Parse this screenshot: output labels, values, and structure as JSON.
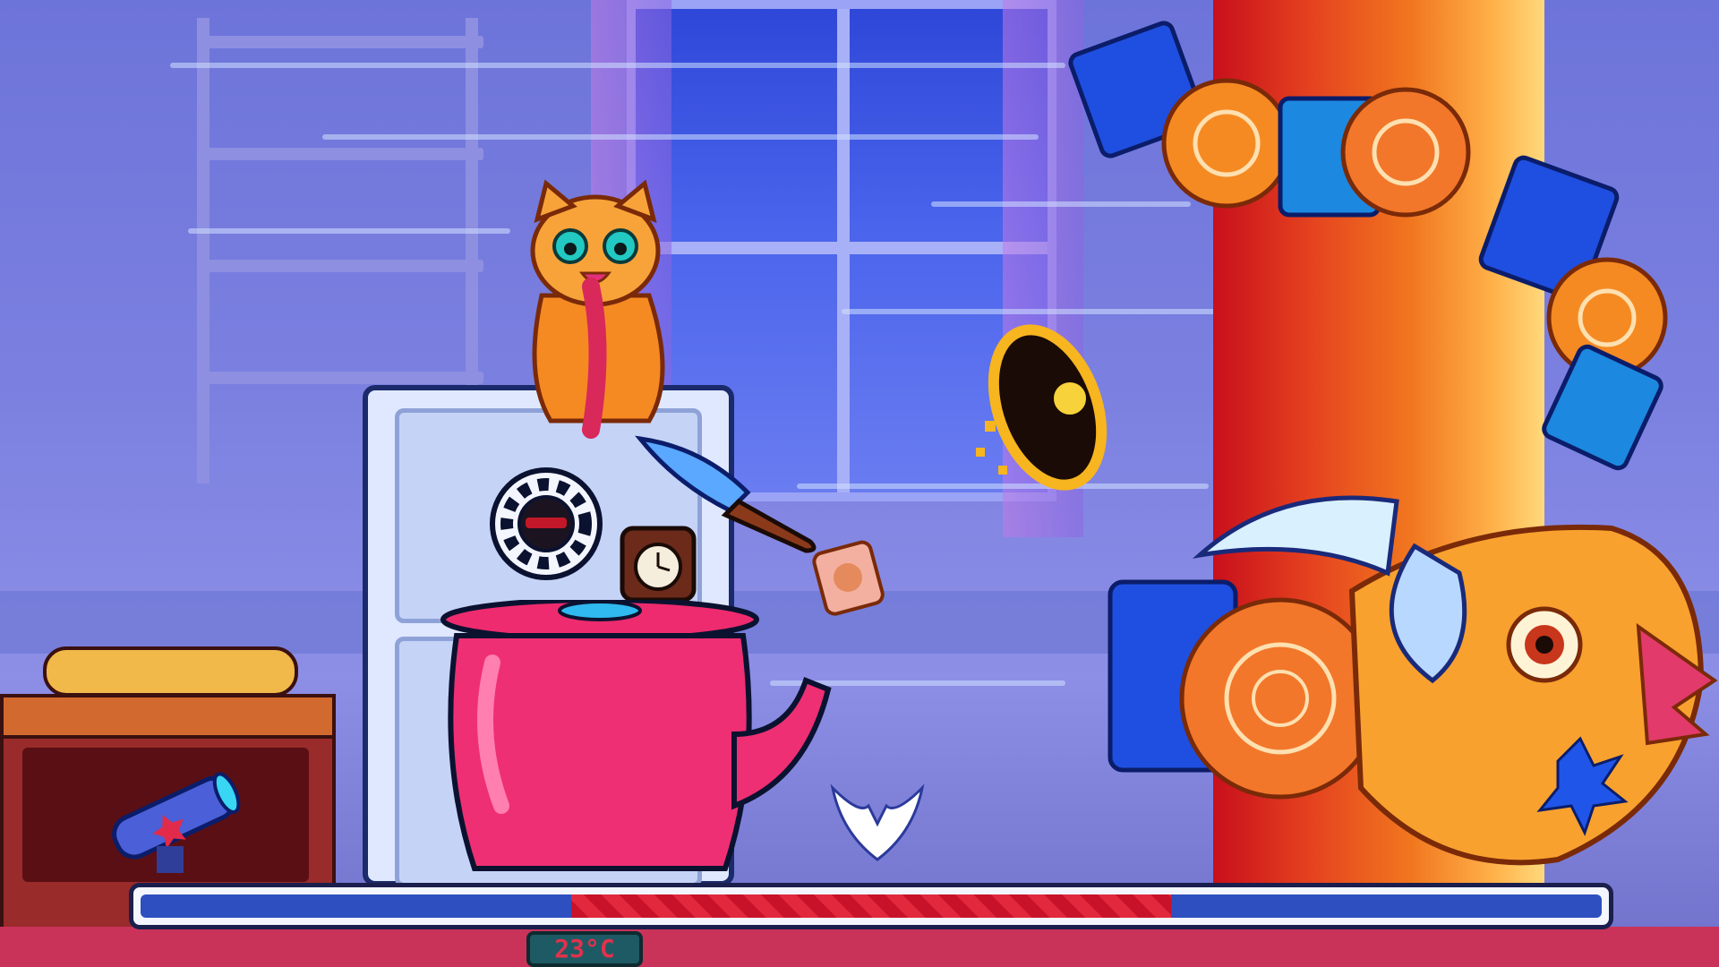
{
  "hud": {
    "thermometer_reading": "23°C",
    "progress_fraction": 0.41,
    "progress_start_fraction": 0.295
  },
  "colors": {
    "sky_window": "#3b55e0",
    "pillar_red": "#c80f1c",
    "kettle_pink": "#ef2f73",
    "progress_red": "#c8122a",
    "progress_track": "#2e4fbf"
  },
  "icons": {
    "cat": "cat-character",
    "telescope": "telescope-icon",
    "knife": "knife-icon",
    "kettle": "kettle-icon",
    "clock": "clock-icon",
    "poker_chip": "poker-chip-icon",
    "dragon_head": "dragon-head-icon",
    "pan": "frying-pan-icon"
  }
}
